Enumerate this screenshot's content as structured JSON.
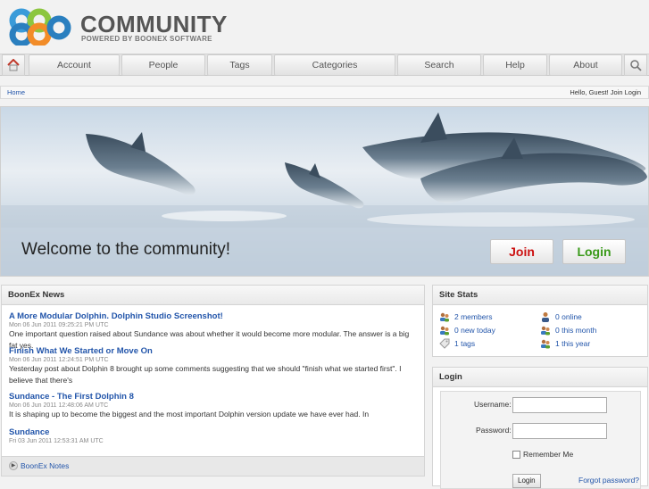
{
  "brand": {
    "name": "COMMUNITY",
    "tagline": "POWERED BY BOONEX SOFTWARE"
  },
  "nav": {
    "items": [
      "Account",
      "People",
      "Tags",
      "Categories",
      "Search",
      "Help",
      "About"
    ]
  },
  "breadcrumb": {
    "home": "Home",
    "greeting": "Hello, Guest!",
    "join": "Join",
    "login": "Login"
  },
  "banner": {
    "welcome": "Welcome to the community!",
    "join_label": "Join",
    "login_label": "Login",
    "join_color": "#cc1111",
    "login_color": "#3a9a1a"
  },
  "news": {
    "title": "BoonEx News",
    "items": [
      {
        "title": "A More Modular Dolphin. Dolphin Studio Screenshot!",
        "date": "Mon 06 Jun 2011 09:25:21 PM UTC",
        "text": "One important question raised about Sundance was about whether it would become more modular. The answer is a big fat yes."
      },
      {
        "title": "Finish What We Started or Move On",
        "date": "Mon 06 Jun 2011 12:24:51 PM UTC",
        "text": "Yesterday post about Dolphin 8 brought up some comments suggesting that we should \"finish what we started first\". I believe that there's"
      },
      {
        "title": "Sundance - The First Dolphin 8",
        "date": "Mon 06 Jun 2011 12:48:06 AM UTC",
        "text": "It is shaping up to become the biggest and the most important Dolphin version update we have ever had. In"
      },
      {
        "title": "Sundance",
        "date": "Fri 03 Jun 2011 12:53:31 AM UTC",
        "text": ""
      }
    ],
    "footer_link": "BoonEx Notes"
  },
  "stats": {
    "title": "Site Stats",
    "members": "2 members",
    "online": "0 online",
    "new_today": "0 new today",
    "this_month": "0 this month",
    "tags": "1 tags",
    "this_year": "1 this year"
  },
  "login_box": {
    "title": "Login",
    "username_label": "Username:",
    "password_label": "Password:",
    "remember_label": "Remember Me",
    "submit_label": "Login",
    "forgot_label": "Forgot password?"
  }
}
